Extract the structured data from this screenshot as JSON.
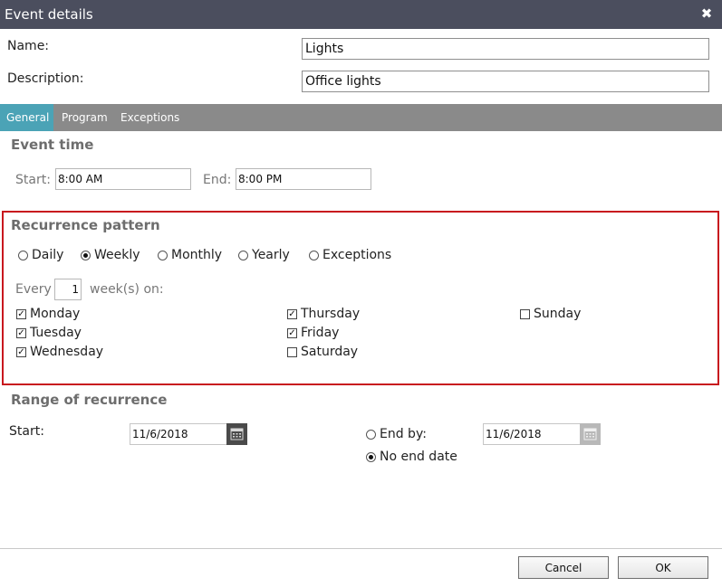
{
  "dialog": {
    "title": "Event details",
    "close_glyph": "✖"
  },
  "form": {
    "name_label": "Name:",
    "name_value": "Lights",
    "description_label": "Description:",
    "description_value": "Office lights"
  },
  "tabs": [
    {
      "label": "General",
      "active": true
    },
    {
      "label": "Program",
      "active": false
    },
    {
      "label": "Exceptions",
      "active": false
    }
  ],
  "event_time": {
    "title": "Event time",
    "start_label": "Start:",
    "start_value": "8:00 AM",
    "end_label": "End:",
    "end_value": "8:00 PM"
  },
  "recurrence": {
    "title": "Recurrence pattern",
    "options": [
      {
        "label": "Daily",
        "checked": false
      },
      {
        "label": "Weekly",
        "checked": true
      },
      {
        "label": "Monthly",
        "checked": false
      },
      {
        "label": "Yearly",
        "checked": false
      },
      {
        "label": "Exceptions",
        "checked": false
      }
    ],
    "every_label": "Every",
    "every_value": "1",
    "weeks_on_label": "week(s) on:",
    "days": [
      {
        "label": "Monday",
        "checked": true
      },
      {
        "label": "Tuesday",
        "checked": true
      },
      {
        "label": "Wednesday",
        "checked": true
      },
      {
        "label": "Thursday",
        "checked": true
      },
      {
        "label": "Friday",
        "checked": true
      },
      {
        "label": "Saturday",
        "checked": false
      },
      {
        "label": "Sunday",
        "checked": false
      }
    ]
  },
  "range": {
    "title": "Range of recurrence",
    "start_label": "Start:",
    "start_value": "11/6/2018",
    "end_by_label": "End by:",
    "end_by_checked": false,
    "end_by_value": "11/6/2018",
    "no_end_label": "No end date",
    "no_end_checked": true
  },
  "footer": {
    "cancel_label": "Cancel",
    "ok_label": "OK"
  },
  "icons": {
    "close": "close-icon",
    "calendar": "calendar-icon"
  },
  "colors": {
    "titlebar": "#4b4e5e",
    "tab_active": "#4ba3b6",
    "tabbar": "#8a8a8a",
    "highlight_border": "#c8181e"
  }
}
